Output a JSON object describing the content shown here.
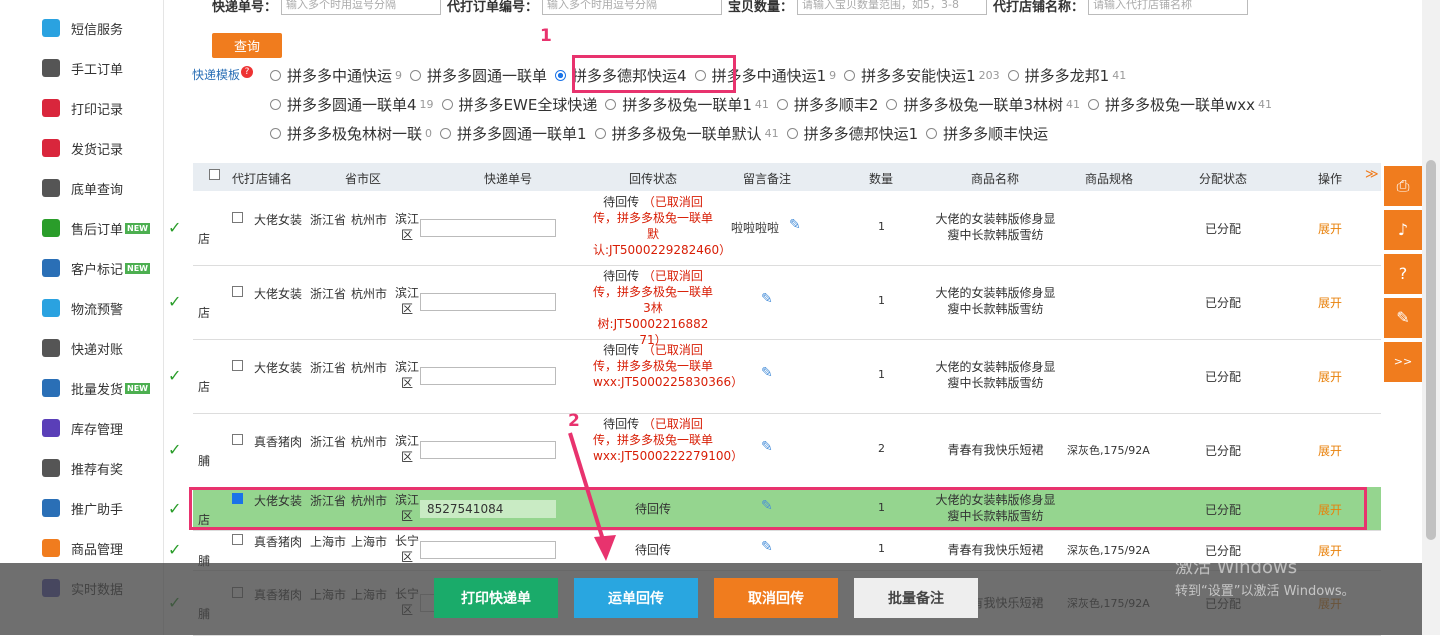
{
  "sidebar": {
    "items": [
      {
        "label": "短信服务",
        "icon": "message-icon",
        "color": "#2aa2e0",
        "new": false
      },
      {
        "label": "手工订单",
        "icon": "printer-icon",
        "color": "#555555",
        "new": false
      },
      {
        "label": "打印记录",
        "icon": "record-icon",
        "color": "#d9263c",
        "new": false
      },
      {
        "label": "发货记录",
        "icon": "list-icon",
        "color": "#d9263c",
        "new": false
      },
      {
        "label": "底单查询",
        "icon": "barcode-icon",
        "color": "#555555",
        "new": false
      },
      {
        "label": "售后订单",
        "icon": "aftersale-icon",
        "color": "#2a9d2a",
        "new": true
      },
      {
        "label": "客户标记",
        "icon": "customer-icon",
        "color": "#2a6fb6",
        "new": true
      },
      {
        "label": "物流预警",
        "icon": "truck-icon",
        "color": "#2aa2e0",
        "new": false
      },
      {
        "label": "快递对账",
        "icon": "ledger-icon",
        "color": "#555555",
        "new": false
      },
      {
        "label": "批量发货",
        "icon": "batch-icon",
        "color": "#2a6fb6",
        "new": true
      },
      {
        "label": "库存管理",
        "icon": "warehouse-icon",
        "color": "#5a3fb8",
        "new": false
      },
      {
        "label": "推荐有奖",
        "icon": "gift-icon",
        "color": "#555555",
        "new": false
      },
      {
        "label": "推广助手",
        "icon": "chart-icon",
        "color": "#2a6fb6",
        "new": false
      },
      {
        "label": "商品管理",
        "icon": "goods-icon",
        "color": "#f07c1e",
        "new": false
      },
      {
        "label": "实时数据",
        "icon": "realtime-icon",
        "color": "#4a4ab8",
        "new": false
      }
    ],
    "new_badge": "NEW"
  },
  "search": {
    "fields": [
      {
        "label": "快递单号：",
        "placeholder": "输入多个时用逗号分隔"
      },
      {
        "label": "代打订单编号：",
        "placeholder": "输入多个时用逗号分隔"
      },
      {
        "label": "宝贝数量：",
        "placeholder": "请输入宝贝数量范围，如5，3-8"
      },
      {
        "label": "代打店铺名称：",
        "placeholder": "请输入代打店铺名称"
      }
    ],
    "query_label": "查询"
  },
  "template_label": "快递模板",
  "templates": [
    [
      {
        "name": "拼多多中通快运",
        "count": "9",
        "checked": false
      },
      {
        "name": "拼多多圆通一联单",
        "count": "",
        "checked": false
      },
      {
        "name": "拼多多德邦快运4",
        "count": "",
        "checked": true
      },
      {
        "name": "拼多多中通快运1",
        "count": "9",
        "checked": false
      },
      {
        "name": "拼多多安能快运1",
        "count": "203",
        "checked": false
      },
      {
        "name": "拼多多龙邦1",
        "count": "41",
        "checked": false
      }
    ],
    [
      {
        "name": "拼多多圆通一联单4",
        "count": "19",
        "checked": false
      },
      {
        "name": "拼多多EWE全球快递",
        "count": "",
        "checked": false
      },
      {
        "name": "拼多多极兔一联单1",
        "count": "41",
        "checked": false
      },
      {
        "name": "拼多多顺丰2",
        "count": "",
        "checked": false
      },
      {
        "name": "拼多多极兔一联单3林树",
        "count": "41",
        "checked": false
      },
      {
        "name": "拼多多极兔一联单wxx",
        "count": "41",
        "checked": false
      }
    ],
    [
      {
        "name": "拼多多极兔林树一联",
        "count": "0",
        "checked": false
      },
      {
        "name": "拼多多圆通一联单1",
        "count": "",
        "checked": false
      },
      {
        "name": "拼多多极兔一联单默认",
        "count": "41",
        "checked": false
      },
      {
        "name": "拼多多德邦快运1",
        "count": "",
        "checked": false
      },
      {
        "name": "拼多多顺丰快运",
        "count": "",
        "checked": false
      }
    ]
  ],
  "annotations": {
    "first": "1",
    "second": "2"
  },
  "table": {
    "columns": [
      "代打店铺名",
      "省市区",
      "快递单号",
      "回传状态",
      "留言备注",
      "数量",
      "商品名称",
      "商品规格",
      "分配状态",
      "操作"
    ],
    "rows": [
      {
        "shop": "大佬女装",
        "shop_suffix": "店",
        "province": "浙江省",
        "city": "杭州市",
        "district": "滨江区",
        "tracking": "",
        "status": "待回传",
        "status_note": "（已取消回传，拼多多极兔一联单默认:JT5000229282460）",
        "remark": "啦啦啦啦",
        "qty": "1",
        "product": "大佬的女装韩版修身显瘦中长款韩版雪纺",
        "spec": "",
        "assign": "已分配",
        "op": "展开",
        "checked": false
      },
      {
        "shop": "大佬女装",
        "shop_suffix": "店",
        "province": "浙江省",
        "city": "杭州市",
        "district": "滨江区",
        "tracking": "",
        "status": "待回传",
        "status_note": "（已取消回传，拼多多极兔一联单3林树:JT50002216882 71）",
        "remark": "",
        "qty": "1",
        "product": "大佬的女装韩版修身显瘦中长款韩版雪纺",
        "spec": "",
        "assign": "已分配",
        "op": "展开",
        "checked": false
      },
      {
        "shop": "大佬女装",
        "shop_suffix": "店",
        "province": "浙江省",
        "city": "杭州市",
        "district": "滨江区",
        "tracking": "",
        "status": "待回传",
        "status_note": "（已取消回传，拼多多极兔一联单wxx:JT5000225830366）",
        "remark": "",
        "qty": "1",
        "product": "大佬的女装韩版修身显瘦中长款韩版雪纺",
        "spec": "",
        "assign": "已分配",
        "op": "展开",
        "checked": false
      },
      {
        "shop": "真香猪肉",
        "shop_suffix": "脯",
        "province": "浙江省",
        "city": "杭州市",
        "district": "滨江区",
        "tracking": "",
        "status": "待回传",
        "status_note": "（已取消回传，拼多多极兔一联单wxx:JT5000222279100）",
        "remark": "",
        "qty": "2",
        "product": "青春有我快乐短裙",
        "spec": "深灰色,175/92A",
        "assign": "已分配",
        "op": "展开",
        "checked": false
      },
      {
        "shop": "大佬女装",
        "shop_suffix": "店",
        "province": "浙江省",
        "city": "杭州市",
        "district": "滨江区",
        "tracking": "8527541084",
        "status": "待回传",
        "status_note": "",
        "remark": "",
        "qty": "1",
        "product": "大佬的女装韩版修身显瘦中长款韩版雪纺",
        "spec": "",
        "assign": "已分配",
        "op": "展开",
        "checked": true
      },
      {
        "shop": "真香猪肉",
        "shop_suffix": "脯",
        "province": "上海市",
        "city": "上海市",
        "district": "长宁区",
        "tracking": "",
        "status": "待回传",
        "status_note": "",
        "remark": "",
        "qty": "1",
        "product": "青春有我快乐短裙",
        "spec": "深灰色,175/92A",
        "assign": "已分配",
        "op": "展开",
        "checked": false
      },
      {
        "shop": "真香猪肉",
        "shop_suffix": "脯",
        "province": "上海市",
        "city": "上海市",
        "district": "长宁区",
        "tracking": "",
        "status": "",
        "status_note": "",
        "remark": "",
        "qty": "",
        "product": "青春有我快乐短裙",
        "spec": "深灰色,175/92A",
        "assign": "已分配",
        "op": "展开",
        "checked": false
      }
    ]
  },
  "bottom_buttons": [
    {
      "label": "打印快递单",
      "color": "#1aab6a"
    },
    {
      "label": "运单回传",
      "color": "#29a6e0"
    },
    {
      "label": "取消回传",
      "color": "#f07c1e"
    },
    {
      "label": "批量备注",
      "color": "#eeeeee"
    }
  ],
  "watermark": {
    "title": "激活 Windows",
    "subtitle": "转到“设置”以激活 Windows。"
  }
}
